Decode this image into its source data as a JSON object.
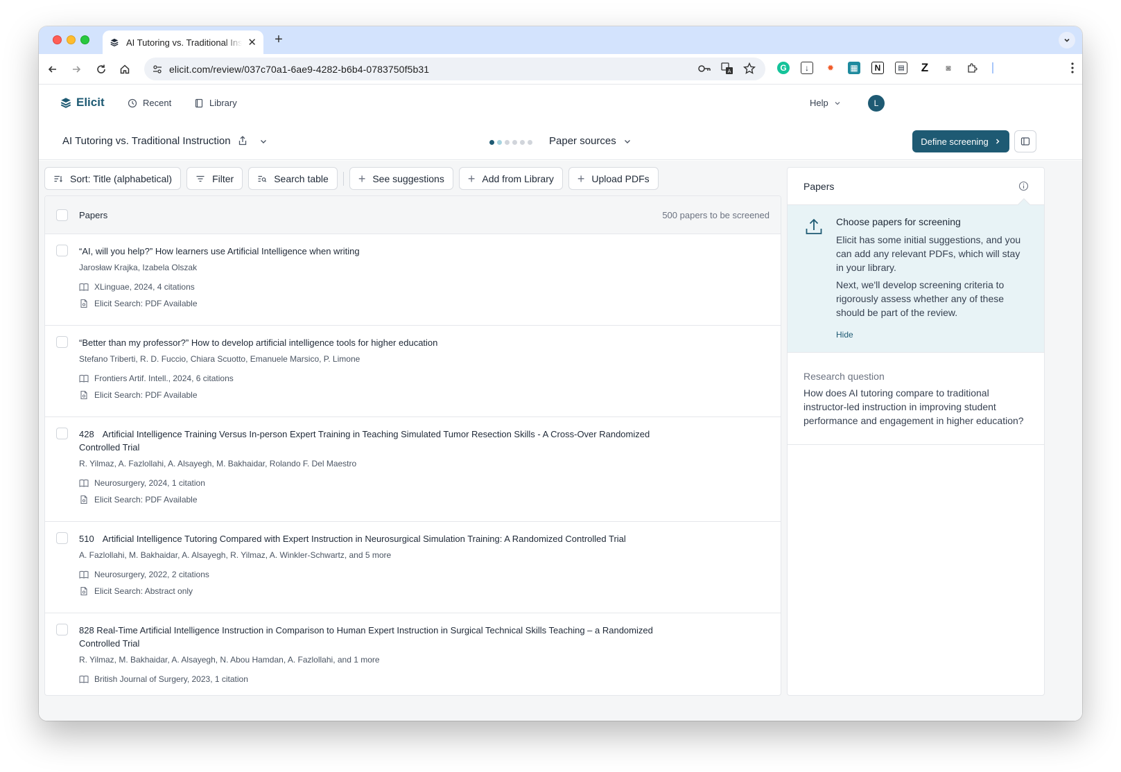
{
  "browser": {
    "tab_title": "AI Tutoring vs. Traditional Instruction",
    "url": "elicit.com/review/037c70a1-6ae9-4282-b6b4-0783750f5b31"
  },
  "app": {
    "brand": "Elicit",
    "nav": {
      "recent": "Recent",
      "library": "Library",
      "help": "Help"
    },
    "avatar_initial": "L",
    "review_title": "AI Tutoring vs. Traditional Instruction",
    "stage_label": "Paper sources",
    "progress": {
      "current_step": 1,
      "total_steps": 6
    },
    "define_button": "Define screening",
    "accent_color": "#1e5a73"
  },
  "actions": {
    "sort": "Sort: Title (alphabetical)",
    "filter": "Filter",
    "search_table": "Search table",
    "see_suggestions": "See suggestions",
    "add_from_library": "Add from Library",
    "upload_pdfs": "Upload PDFs"
  },
  "table": {
    "header_label": "Papers",
    "count_label": "500 papers to be screened",
    "rows": [
      {
        "num": "",
        "title": "“AI, will you help?” How learners use Artificial Intelligence when writing",
        "authors": "Jarosław Krajka, Izabela Olszak",
        "venue": "XLinguae, 2024, 4 citations",
        "source": "Elicit Search: PDF Available"
      },
      {
        "num": "",
        "title": "“Better than my professor?” How to develop artificial intelligence tools for higher education",
        "authors": "Stefano Triberti, R. D. Fuccio, Chiara Scuotto, Emanuele Marsico, P. Limone",
        "venue": "Frontiers Artif. Intell., 2024, 6 citations",
        "source": "Elicit Search: PDF Available"
      },
      {
        "num": "428",
        "title": "Artificial Intelligence Training Versus In-person Expert Training in Teaching Simulated Tumor Resection Skills - A Cross-Over Randomized Controlled Trial",
        "authors": "R. Yilmaz, A. Fazlollahi, A. Alsayegh, M. Bakhaidar, Rolando F. Del Maestro",
        "venue": "Neurosurgery, 2024, 1 citation",
        "source": "Elicit Search: PDF Available"
      },
      {
        "num": "510",
        "title": "Artificial Intelligence Tutoring Compared with Expert Instruction in Neurosurgical Simulation Training: A Randomized Controlled Trial",
        "authors": "A. Fazlollahi, M. Bakhaidar, A. Alsayegh, R. Yilmaz, A. Winkler-Schwartz, and 5 more",
        "venue": "Neurosurgery, 2022, 2 citations",
        "source": "Elicit Search: Abstract only"
      },
      {
        "num": "",
        "title": "828 Real-Time Artificial Intelligence Instruction in Comparison to Human Expert Instruction in Surgical Technical Skills Teaching – a Randomized Controlled Trial",
        "authors": "R. Yilmaz, M. Bakhaidar, A. Alsayegh, N. Abou Hamdan, A. Fazlollahi, and 1 more",
        "venue": "British Journal of Surgery, 2023, 1 citation",
        "source": ""
      }
    ]
  },
  "side_panel": {
    "title": "Papers",
    "callout_title": "Choose papers for screening",
    "callout_p1": "Elicit has some initial suggestions, and you can add any relevant PDFs, which will stay in your library.",
    "callout_p2": "Next, we'll develop screening criteria to rigorously assess whether any of these should be part of the review.",
    "hide_label": "Hide",
    "rq_label": "Research question",
    "rq_text": "How does AI tutoring compare to traditional instructor-led instruction in improving student performance and engagement in higher education?"
  }
}
